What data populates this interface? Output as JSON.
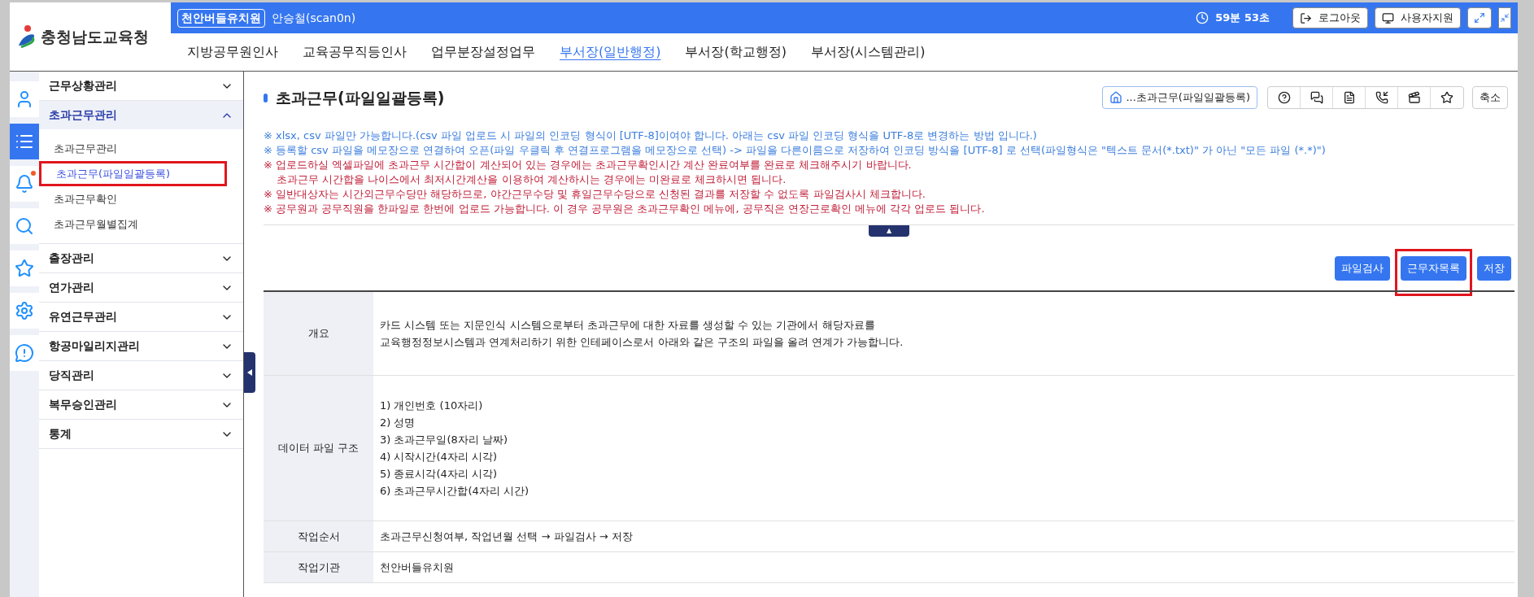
{
  "header": {
    "logo_text": "충청남도교육청",
    "school": "천안버들유치원",
    "user": "안승철(scan0n)",
    "timer": "59분 53초",
    "buttons": [
      "로그아웃",
      "사용자지원"
    ]
  },
  "nav": [
    {
      "label": "지방공무원인사",
      "selected": false
    },
    {
      "label": "교육공무직등인사",
      "selected": false
    },
    {
      "label": "업무분장설정업무",
      "selected": false
    },
    {
      "label": "부서장(일반행정)",
      "selected": true
    },
    {
      "label": "부서장(학교행정)",
      "selected": false
    },
    {
      "label": "부서장(시스템관리)",
      "selected": false
    }
  ],
  "icon_bar": [
    {
      "kind": "person",
      "selected": false,
      "badge": false
    },
    {
      "kind": "menu",
      "selected": true,
      "badge": false
    },
    {
      "kind": "bell",
      "selected": false,
      "badge": true
    },
    {
      "kind": "search",
      "selected": false,
      "badge": false
    },
    {
      "kind": "star",
      "selected": false,
      "badge": false
    },
    {
      "kind": "gear",
      "selected": false,
      "badge": false
    },
    {
      "kind": "alert",
      "selected": false,
      "badge": false
    }
  ],
  "sidebar": [
    {
      "label": "근무상황관리",
      "expanded": false
    },
    {
      "label": "초과근무관리",
      "expanded": true,
      "children": [
        {
          "label": "초과근무관리",
          "selected": false,
          "highlighted": false
        },
        {
          "label": "초과근무(파일일괄등록)",
          "selected": true,
          "highlighted": true
        },
        {
          "label": "초과근무확인",
          "selected": false,
          "highlighted": false
        },
        {
          "label": "초과근무월별집계",
          "selected": false,
          "highlighted": false
        }
      ]
    },
    {
      "label": "출장관리",
      "expanded": false
    },
    {
      "label": "연가관리",
      "expanded": false
    },
    {
      "label": "유연근무관리",
      "expanded": false
    },
    {
      "label": "항공마일리지관리",
      "expanded": false
    },
    {
      "label": "당직관리",
      "expanded": false
    },
    {
      "label": "복무승인관리",
      "expanded": false
    },
    {
      "label": "통계",
      "expanded": false
    }
  ],
  "page": {
    "title": "초과근무(파일일괄등록)",
    "breadcrumb": "...초과근무(파일일괄등록)",
    "toolbar_icons": [
      {
        "kind": "help"
      },
      {
        "kind": "chat"
      },
      {
        "kind": "document"
      },
      {
        "kind": "phone"
      },
      {
        "kind": "video"
      },
      {
        "kind": "star"
      }
    ],
    "shrink_button": "축소"
  },
  "notes": [
    {
      "text": "※ xlsx, csv 파일만 가능합니다.(csv 파일 업로드 시 파일의 인코딩 형식이 [UTF-8]이여야 합니다. 아래는 csv 파일 인코딩 형식을 UTF-8로 변경하는 방법 입니다.)",
      "color": "#3b7ddd"
    },
    {
      "text": "※ 등록할 csv 파일을 메모장으로 연결하여 오픈(파일 우클릭 후 연결프로그램을 메모장으로 선택) -> 파일을 다른이름으로 저장하여 인코딩 방식을 [UTF-8] 로 선택(파일형식은 \"텍스트 문서(*.txt)\" 가 아닌 \"모든 파일 (*.*)\")",
      "color": "#3b7ddd"
    },
    {
      "text": "※ 업로드하실 엑셀파일에 초과근무 시간합이 계산되어 있는 경우에는 초과근무확인시간 계산 완료여부를 완료로 체크해주시기 바랍니다.",
      "color": "#c0203a"
    },
    {
      "text": "초과근무 시간합을 나이스에서 최저시간계산을 이용하여 계산하시는 경우에는 미완료로 체크하시면 됩니다.",
      "color": "#c0203a"
    },
    {
      "text": "※ 일반대상자는 시간외근무수당만 해당하므로, 야간근무수당 및 휴일근무수당으로 신청된 결과를 저장할 수 없도록 파일검사시 체크합니다.",
      "color": "#c0203a"
    },
    {
      "text": "※ 공무원과 공무직원을 한파일로 한번에 업로드 가능합니다. 이 경우 공무원은 초과근무확인 메뉴에, 공무직은 연장근로확인 메뉴에 각각 업로드 됩니다.",
      "color": "#c0203a"
    }
  ],
  "collapse_handle": "▲",
  "actions": [
    {
      "label": "파일검사",
      "highlighted": false
    },
    {
      "label": "근무자목록",
      "highlighted": true
    },
    {
      "label": "저장",
      "highlighted": false
    }
  ],
  "table": [
    {
      "header": "개요",
      "lines": [
        "카드 시스템 또는 지문인식 시스템으로부터 초과근무에 대한 자료를 생성할 수 있는 기관에서 해당자료를",
        "교육행정정보시스템과 연계처리하기 위한 인테페이스로서 아래와 같은 구조의 파일을 올려 연계가 가능합니다."
      ]
    },
    {
      "header": "데이터 파일 구조",
      "lines": [
        "1) 개인번호 (10자리)",
        "2) 성명",
        "3) 초과근무일(8자리 날짜)",
        "4) 시작시간(4자리 시각)",
        "5) 종료시각(4자리 시각)",
        "6) 초과근무시간합(4자리 시간)"
      ]
    },
    {
      "header": "작업순서",
      "lines": [
        "초과근무신청여부, 작업년월 선택 → 파일검사 → 저장"
      ]
    },
    {
      "header": "작업기관",
      "lines": [
        "천안버들유치원"
      ]
    }
  ]
}
